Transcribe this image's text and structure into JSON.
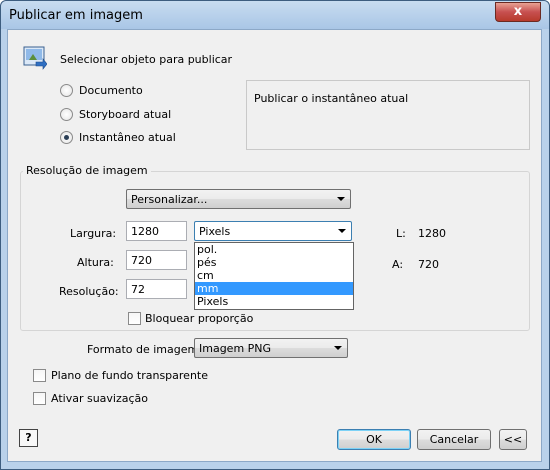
{
  "window": {
    "title": "Publicar em imagem",
    "close_label": "x"
  },
  "select_object": {
    "label": "Selecionar objeto para publicar"
  },
  "radios": [
    {
      "label": "Documento",
      "checked": false
    },
    {
      "label": "Storyboard atual",
      "checked": false
    },
    {
      "label": "Instantâneo atual",
      "checked": true
    }
  ],
  "description": "Publicar o instantâneo atual",
  "resolution_group": {
    "title": "Resolução de imagem",
    "preset": "Personalizar...",
    "width_label": "Largura:",
    "width_value": "1280",
    "height_label": "Altura:",
    "height_value": "720",
    "resolution_label": "Resolução:",
    "resolution_value": "72",
    "unit_selected": "Pixels",
    "unit_options": [
      "pol.",
      "pés",
      "cm",
      "mm",
      "Pixels"
    ],
    "unit_highlighted": "mm",
    "summary_w_label": "L:",
    "summary_w_value": "1280",
    "summary_h_label": "A:",
    "summary_h_value": "720",
    "lock_label": "Bloquear proporção"
  },
  "format": {
    "label": "Formato de imagem:",
    "value": "Imagem PNG"
  },
  "options": {
    "transparent_label": "Plano de fundo transparente",
    "smoothing_label": "Ativar suavização"
  },
  "buttons": {
    "help": "?",
    "ok": "OK",
    "cancel": "Cancelar",
    "collapse": "<<"
  }
}
